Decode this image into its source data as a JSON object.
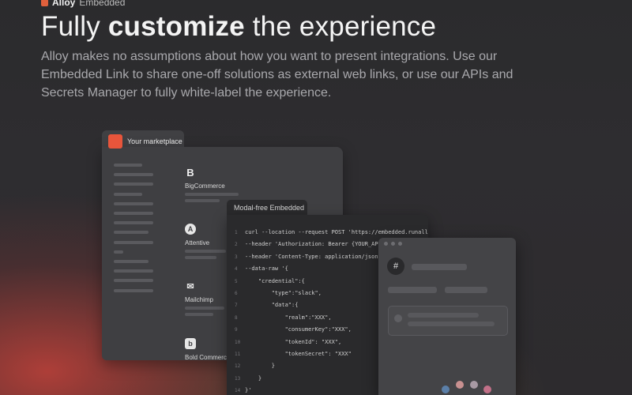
{
  "brand": {
    "name": "Alloy",
    "product": "Embedded"
  },
  "headline": {
    "pre": "Fully",
    "strong": "customize",
    "post": "the experience"
  },
  "subtitle": "Alloy makes no assumptions about how you want to present integrations. Use our Embedded Link to share one-off solutions as external web links, or use our APIs and Secrets Manager to fully white-label the experience.",
  "marketplace": {
    "title": "Your marketplace",
    "apps": [
      {
        "name": "BigCommerce",
        "icon": "bigcommerce-icon",
        "glyph": "B"
      },
      {
        "name": "Attentive",
        "icon": "attentive-icon",
        "glyph": "A"
      },
      {
        "name": "Mailchimp",
        "icon": "mailchimp-icon",
        "glyph": "✉"
      },
      {
        "name": "Bold Commerce",
        "icon": "bold-commerce-icon",
        "glyph": "b"
      }
    ]
  },
  "code": {
    "tab": "Modal-free Embedded",
    "lines": [
      "curl --location --request POST 'https://embedded.runalloy.co",
      "--header 'Authorization: Bearer {YOUR_API_KE",
      "--header 'Content-Type: application/json' \\",
      "--data-raw '{",
      "    \"credential\":{",
      "        \"type\":\"slack\",",
      "        \"data\":{",
      "            \"realm\":\"XXX\",",
      "            \"consumerKey\":\"XXX\",",
      "            \"tokenId\": \"XXX\",",
      "            \"tokenSecret\": \"XXX\"",
      "        }",
      "    }",
      "}'"
    ],
    "line_numbers": [
      "1",
      "2",
      "3",
      "4",
      "5",
      "6",
      "7",
      "8",
      "9",
      "10",
      "11",
      "12",
      "13",
      "14"
    ]
  },
  "slack": {
    "icon": "slack-icon",
    "glyph": "#"
  },
  "colors": {
    "accent": "#e8553b",
    "background": "#2b2b2d"
  }
}
